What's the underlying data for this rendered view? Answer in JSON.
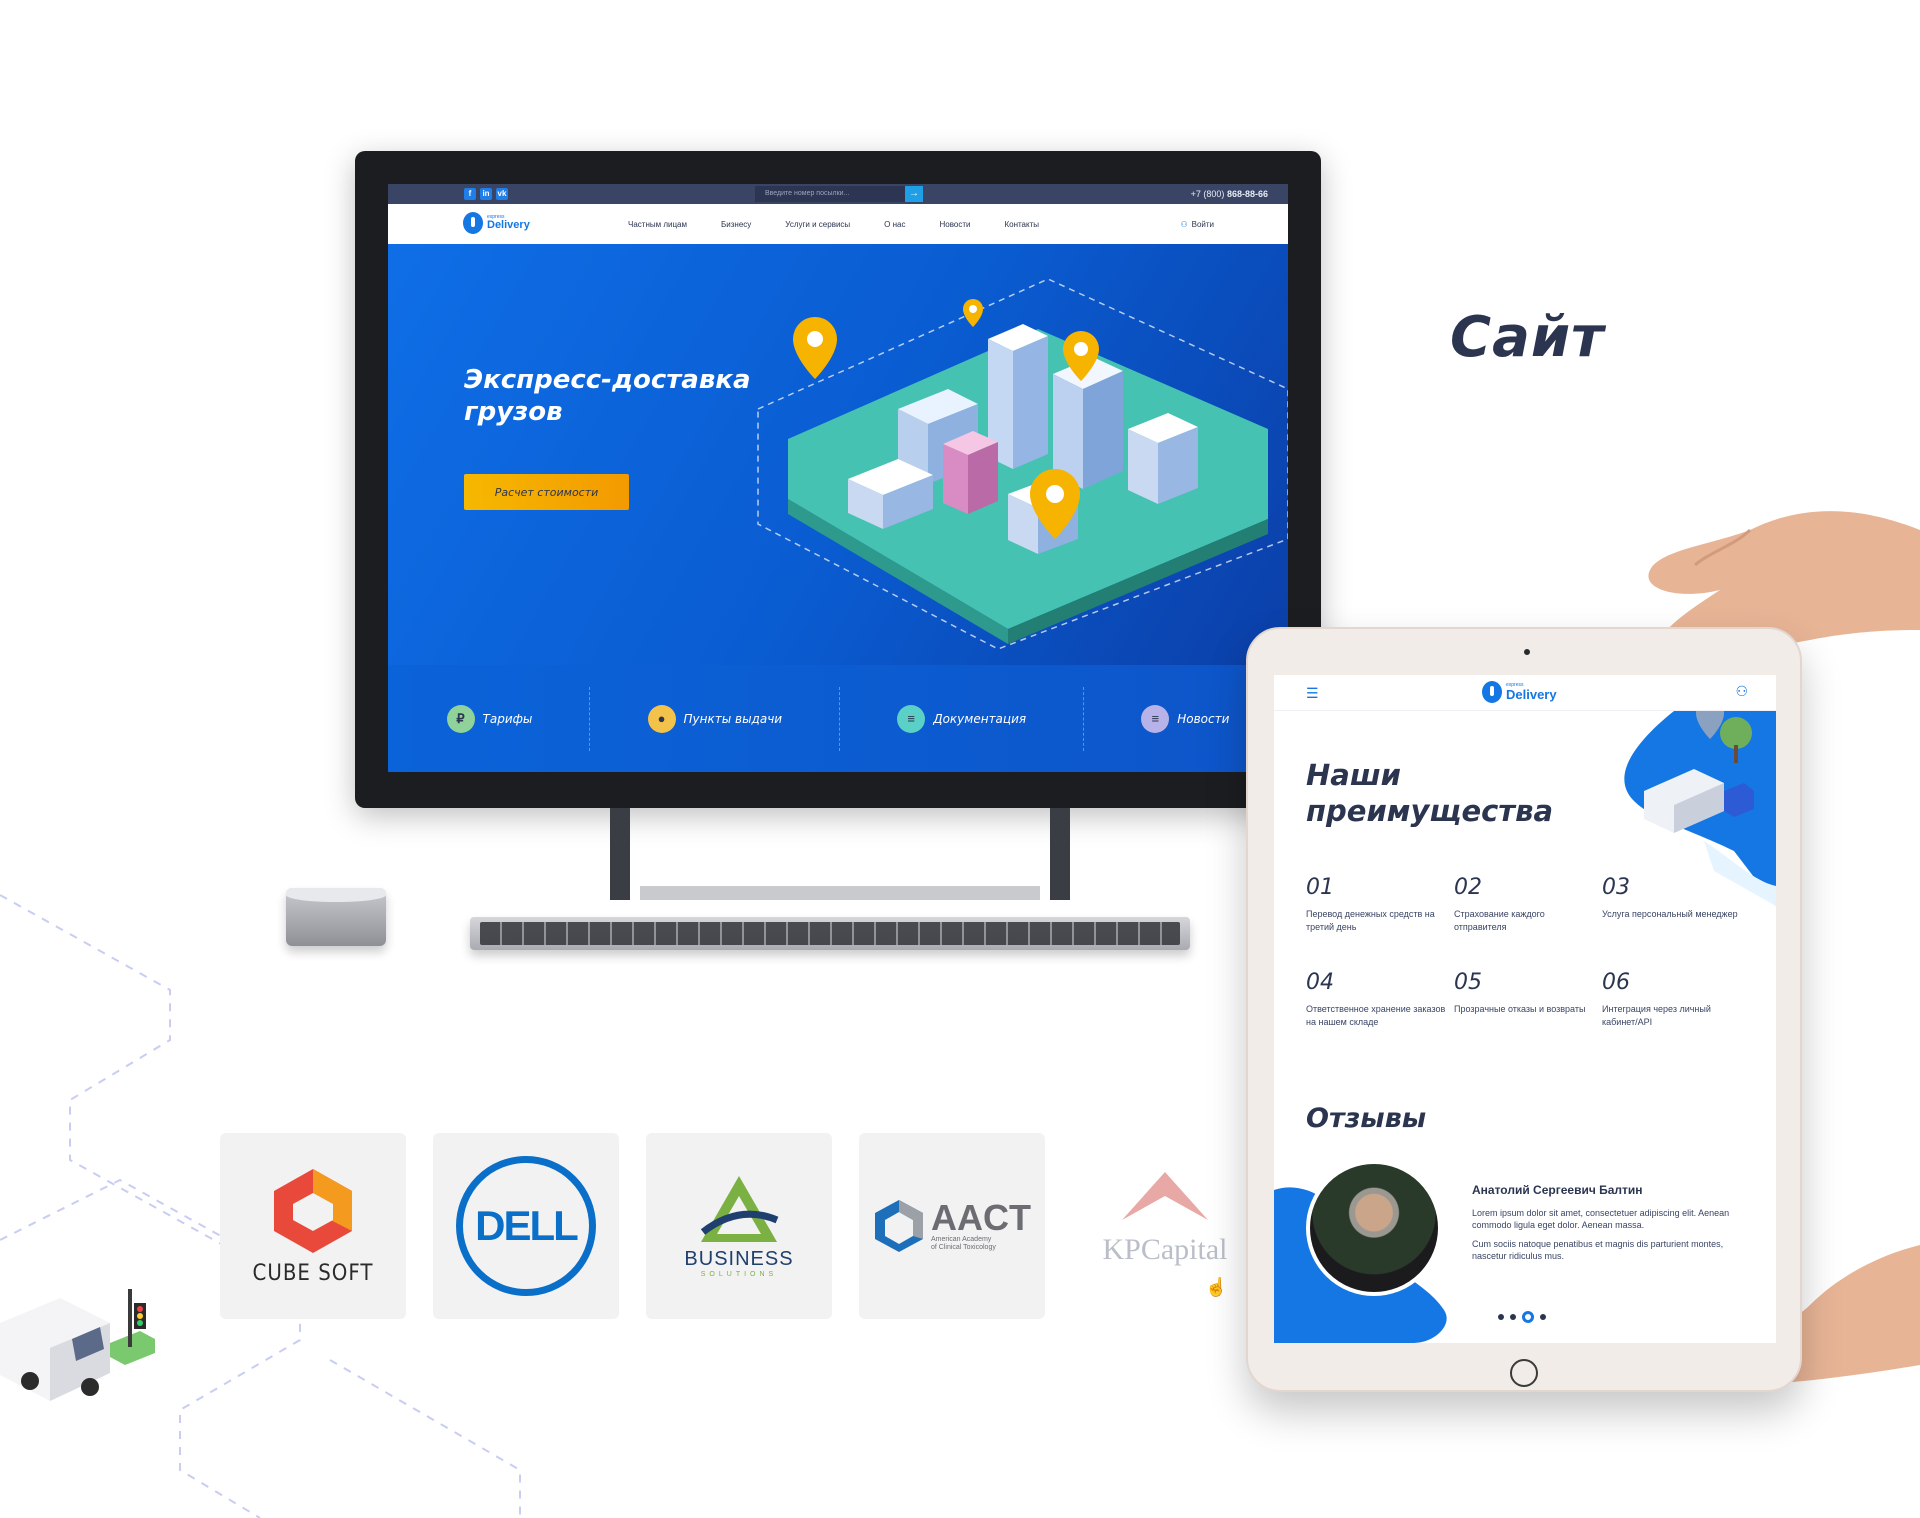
{
  "section": {
    "title": "Сайт"
  },
  "desktop": {
    "topbar": {
      "social": [
        "f",
        "in",
        "vk"
      ],
      "search_placeholder": "Введите номер посылки...",
      "phone_prefix": "+7 (800)",
      "phone_number": "868-88-66"
    },
    "nav": {
      "logo_small": "express",
      "logo_big": "Delivery",
      "items": [
        "Частным лицам",
        "Бизнесу",
        "Услуги и сервисы",
        "О нас",
        "Новости",
        "Контакты"
      ],
      "login": "Войти"
    },
    "hero": {
      "title": "Экспресс-доставка грузов",
      "cta": "Расчет стоимости"
    },
    "quicklinks": [
      {
        "label": "Тарифы",
        "icon": "ruble-icon",
        "glyph": "₽",
        "color": "#8fd39a"
      },
      {
        "label": "Пункты выдачи",
        "icon": "location-icon",
        "glyph": "●",
        "color": "#f3c24a"
      },
      {
        "label": "Документация",
        "icon": "document-icon",
        "glyph": "≡",
        "color": "#5ad0c6"
      },
      {
        "label": "Новости",
        "icon": "news-icon",
        "glyph": "≡",
        "color": "#b7b3e8"
      }
    ]
  },
  "partners": {
    "cube": "CUBE SOFT",
    "dell": "DELL",
    "bs": "BUSINESS",
    "bs_sub": "SOLUTIONS",
    "aact": "AACT",
    "aact_sub1": "American Academy",
    "aact_sub2": "of Clinical Toxicology",
    "kp": "KPCapital"
  },
  "tablet": {
    "logo_small": "express",
    "logo_big": "Delivery",
    "advantages_title": "Наши преимущества",
    "advantages": [
      {
        "num": "01",
        "text": "Перевод денежных средств на третий день"
      },
      {
        "num": "02",
        "text": "Страхование каждого отправителя"
      },
      {
        "num": "03",
        "text": "Услуга персональный менеджер"
      },
      {
        "num": "04",
        "text": "Ответственное хранение заказов на нашем складе"
      },
      {
        "num": "05",
        "text": "Прозрачные отказы и возвраты"
      },
      {
        "num": "06",
        "text": "Интеграция через личный кабинет/API"
      }
    ],
    "reviews_title": "Отзывы",
    "review": {
      "name": "Анатолий Сергеевич Балтин",
      "p1": "Lorem ipsum dolor sit amet, consectetuer adipiscing elit. Aenean commodo ligula eget dolor. Aenean massa.",
      "p2": "Cum sociis natoque penatibus et magnis dis parturient montes, nascetur ridiculus mus."
    }
  }
}
